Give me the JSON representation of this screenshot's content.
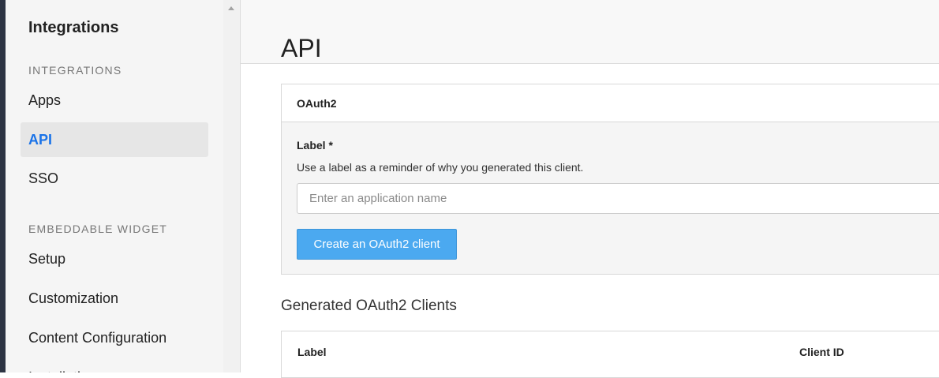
{
  "sidebar": {
    "title": "Integrations",
    "sections": [
      {
        "header": "INTEGRATIONS",
        "items": [
          {
            "label": "Apps",
            "active": false
          },
          {
            "label": "API",
            "active": true
          },
          {
            "label": "SSO",
            "active": false
          }
        ]
      },
      {
        "header": "EMBEDDABLE WIDGET",
        "items": [
          {
            "label": "Setup",
            "active": false
          },
          {
            "label": "Customization",
            "active": false
          },
          {
            "label": "Content Configuration",
            "active": false
          },
          {
            "label": "Installation",
            "active": false
          }
        ]
      }
    ]
  },
  "page": {
    "title": "API"
  },
  "oauth_panel": {
    "heading": "OAuth2",
    "label_field": {
      "label": "Label *",
      "help": "Use a label as a reminder of why you generated this client.",
      "placeholder": "Enter an application name",
      "value": ""
    },
    "create_button": "Create an OAuth2 client"
  },
  "clients": {
    "heading": "Generated OAuth2 Clients",
    "columns": [
      "Label",
      "Client ID"
    ]
  },
  "colors": {
    "accent": "#1a73e8",
    "button": "#4ba9f0",
    "sidebar_bg": "#f5f5f5",
    "left_strip": "#2d3443"
  }
}
